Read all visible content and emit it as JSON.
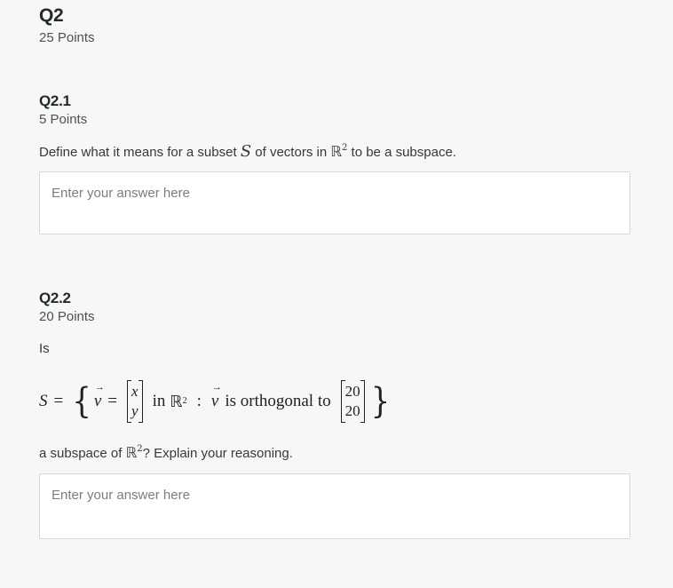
{
  "q2": {
    "title": "Q2",
    "points": "25 Points"
  },
  "q2_1": {
    "title": "Q2.1",
    "points": "5 Points",
    "prompt_before_S": "Define what it means for a subset ",
    "prompt_S": "S",
    "prompt_middle": " of vectors in ",
    "prompt_R": "ℝ",
    "prompt_exp": "2",
    "prompt_after": " to be a subspace.",
    "answer_placeholder": "Enter your answer here",
    "answer_value": ""
  },
  "q2_2": {
    "title": "Q2.2",
    "points": "20 Points",
    "lead": "Is",
    "equation": {
      "set_symbol": "S",
      "equals": "=",
      "open_brace": "{",
      "vec_symbol": "v",
      "vec_equals": "=",
      "vec_components": [
        "x",
        "y"
      ],
      "in_text": "in",
      "space": "ℝ",
      "space_exp": "2",
      "colon": ":",
      "condition": "is orthogonal to",
      "target_components": [
        "20",
        "20"
      ],
      "close_brace": "}"
    },
    "question_before": "a subspace of ",
    "question_R": "ℝ",
    "question_exp": "2",
    "question_after": "? Explain your reasoning.",
    "answer_placeholder": "Enter your answer here",
    "answer_value": ""
  }
}
